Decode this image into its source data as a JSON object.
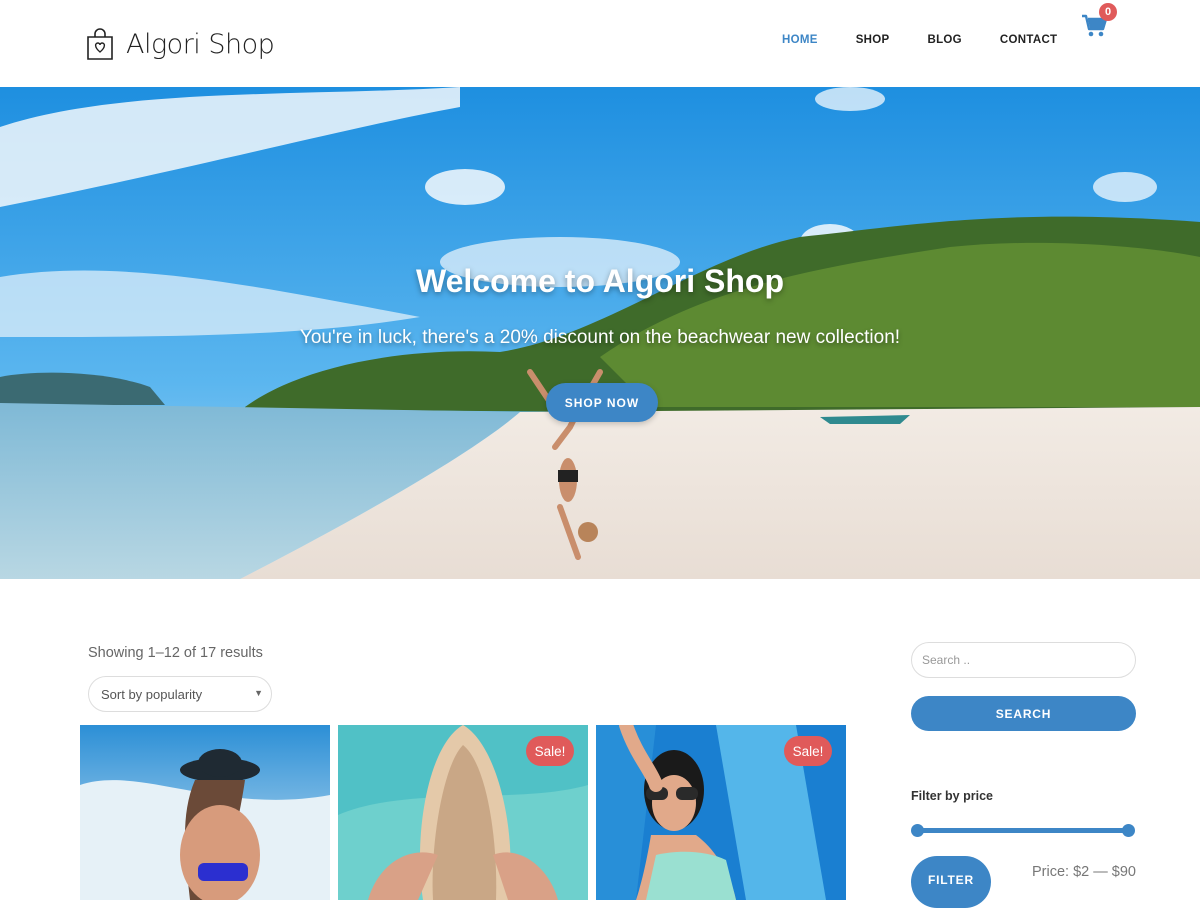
{
  "header": {
    "logo_text": "Algori Shop",
    "nav": [
      {
        "label": "HOME",
        "active": true
      },
      {
        "label": "SHOP",
        "active": false
      },
      {
        "label": "BLOG",
        "active": false
      },
      {
        "label": "CONTACT",
        "active": false
      }
    ],
    "cart_count": "0"
  },
  "hero": {
    "title": "Welcome to Algori Shop",
    "subtitle": "You're in luck, there's a 20% discount on the beachwear new collection!",
    "button_label": "SHOP NOW"
  },
  "shop": {
    "results_text": "Showing 1–12 of 17 results",
    "sort_selected": "Sort by popularity",
    "sale_label": "Sale!",
    "products": [
      {
        "on_sale": false
      },
      {
        "on_sale": true
      },
      {
        "on_sale": true
      }
    ]
  },
  "sidebar": {
    "search_placeholder": "Search ..",
    "search_button": "SEARCH",
    "filter_title": "Filter by price",
    "filter_button": "FILTER",
    "price_text": "Price: $2 — $90"
  },
  "colors": {
    "accent": "#3d86c6",
    "sale": "#e05a5a"
  }
}
